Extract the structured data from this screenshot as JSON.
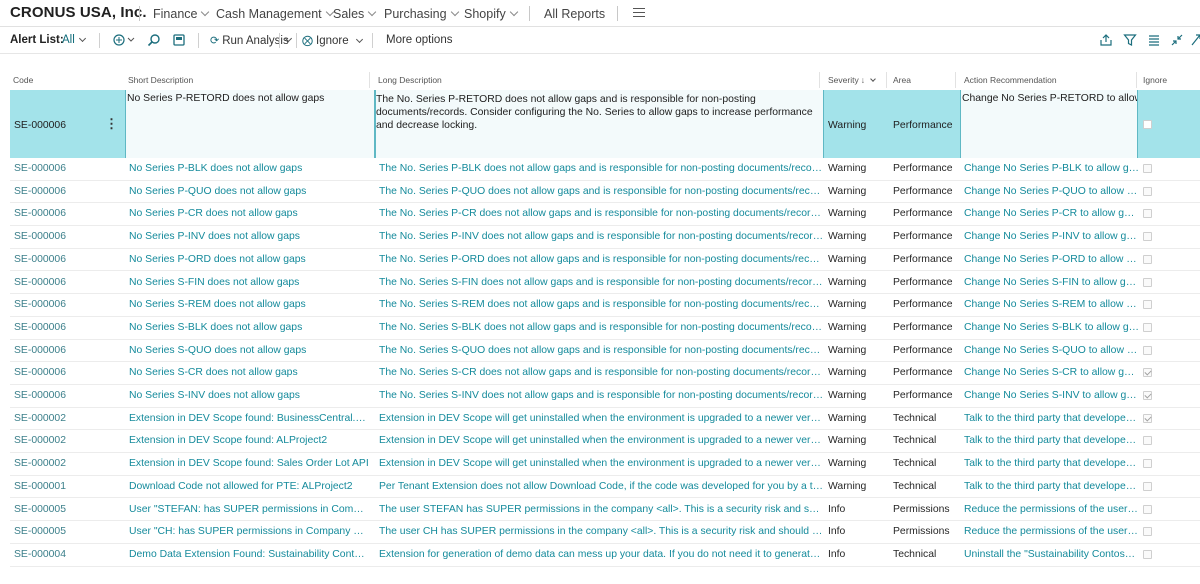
{
  "topnav": {
    "company": "CRONUS USA, Inc.",
    "items": [
      {
        "label": "Finance"
      },
      {
        "label": "Cash Management"
      },
      {
        "label": "Sales"
      },
      {
        "label": "Purchasing"
      },
      {
        "label": "Shopify"
      }
    ],
    "all_reports": "All Reports"
  },
  "actionbar": {
    "alert_list_label": "Alert List:",
    "filter_value": "All",
    "run_analysis": "Run Analysis",
    "ignore": "Ignore",
    "more_options": "More options"
  },
  "columns": {
    "code": "Code",
    "short": "Short Description",
    "long": "Long Description",
    "severity": "Severity",
    "area": "Area",
    "action": "Action Recommendation",
    "ignore": "Ignore"
  },
  "selected": {
    "code": "SE-000006",
    "short": "No Series P-RETORD does not allow gaps",
    "long": "The No. Series P-RETORD does not allow gaps and is responsible for non-posting documents/records. Consider configuring the No. Series to allow gaps to increase performance and decrease locking.",
    "severity": "Warning",
    "area": "Performance",
    "action": "Change No Series P-RETORD to allow gaps",
    "ignore": false
  },
  "rows": [
    {
      "code": "SE-000006",
      "short": "No Series P-BLK does not allow gaps",
      "long": "The No. Series P-BLK does not allow gaps and is responsible for non-posting documents/records. Consider configuring the No. Series to allow gaps",
      "severity": "Warning",
      "area": "Performance",
      "action": "Change No Series P-BLK to allow gaps",
      "ignore": false
    },
    {
      "code": "SE-000006",
      "short": "No Series P-QUO does not allow gaps",
      "long": "The No. Series P-QUO does not allow gaps and is responsible for non-posting documents/records. Consider configuring the No. Series to allow gaps",
      "severity": "Warning",
      "area": "Performance",
      "action": "Change No Series P-QUO to allow gaps",
      "ignore": false
    },
    {
      "code": "SE-000006",
      "short": "No Series P-CR does not allow gaps",
      "long": "The No. Series P-CR does not allow gaps and is responsible for non-posting documents/records. Consider configuring the No. Series to allow gaps",
      "severity": "Warning",
      "area": "Performance",
      "action": "Change No Series P-CR to allow gaps",
      "ignore": false
    },
    {
      "code": "SE-000006",
      "short": "No Series P-INV does not allow gaps",
      "long": "The No. Series P-INV does not allow gaps and is responsible for non-posting documents/records. Consider configuring the No. Series to allow gaps",
      "severity": "Warning",
      "area": "Performance",
      "action": "Change No Series P-INV to allow gaps",
      "ignore": false
    },
    {
      "code": "SE-000006",
      "short": "No Series P-ORD does not allow gaps",
      "long": "The No. Series P-ORD does not allow gaps and is responsible for non-posting documents/records. Consider configuring the No. Series to allow gaps",
      "severity": "Warning",
      "area": "Performance",
      "action": "Change No Series P-ORD to allow gaps",
      "ignore": false
    },
    {
      "code": "SE-000006",
      "short": "No Series S-FIN does not allow gaps",
      "long": "The No. Series S-FIN does not allow gaps and is responsible for non-posting documents/records. Consider configuring the No. Series to allow gaps",
      "severity": "Warning",
      "area": "Performance",
      "action": "Change No Series S-FIN to allow gaps",
      "ignore": false
    },
    {
      "code": "SE-000006",
      "short": "No Series S-REM does not allow gaps",
      "long": "The No. Series S-REM does not allow gaps and is responsible for non-posting documents/records. Consider configuring the No. Series to allow gaps",
      "severity": "Warning",
      "area": "Performance",
      "action": "Change No Series S-REM to allow gaps",
      "ignore": false
    },
    {
      "code": "SE-000006",
      "short": "No Series S-BLK does not allow gaps",
      "long": "The No. Series S-BLK does not allow gaps and is responsible for non-posting documents/records. Consider configuring the No. Series to allow gaps",
      "severity": "Warning",
      "area": "Performance",
      "action": "Change No Series S-BLK to allow gaps",
      "ignore": false
    },
    {
      "code": "SE-000006",
      "short": "No Series S-QUO does not allow gaps",
      "long": "The No. Series S-QUO does not allow gaps and is responsible for non-posting documents/records. Consider configuring the No. Series to allow gaps",
      "severity": "Warning",
      "area": "Performance",
      "action": "Change No Series S-QUO to allow gaps",
      "ignore": false
    },
    {
      "code": "SE-000006",
      "short": "No Series S-CR does not allow gaps",
      "long": "The No. Series S-CR does not allow gaps and is responsible for non-posting documents/records. Consider configuring the No. Series to allow gaps",
      "severity": "Warning",
      "area": "Performance",
      "action": "Change No Series S-CR to allow gaps",
      "ignore": true
    },
    {
      "code": "SE-000006",
      "short": "No Series S-INV does not allow gaps",
      "long": "The No. Series S-INV does not allow gaps and is responsible for non-posting documents/records. Consider configuring the No. Series to allow gaps",
      "severity": "Warning",
      "area": "Performance",
      "action": "Change No Series S-INV to allow gaps",
      "ignore": true
    },
    {
      "code": "SE-000002",
      "short": "Extension in DEV Scope found: BusinessCentral.Sentinel",
      "long": "Extension in DEV Scope will get uninstalled when the environment is upgraded to a newer version. Publishing the extension",
      "severity": "Warning",
      "area": "Technical",
      "action": "Talk to the third party that developed the extension",
      "ignore": true
    },
    {
      "code": "SE-000002",
      "short": "Extension in DEV Scope found: ALProject2",
      "long": "Extension in DEV Scope will get uninstalled when the environment is upgraded to a newer version. Publishing the extension",
      "severity": "Warning",
      "area": "Technical",
      "action": "Talk to the third party that developed the extension",
      "ignore": false
    },
    {
      "code": "SE-000002",
      "short": "Extension in DEV Scope found: Sales Order Lot API",
      "long": "Extension in DEV Scope will get uninstalled when the environment is upgraded to a newer version. Publishing the extension",
      "severity": "Warning",
      "area": "Technical",
      "action": "Talk to the third party that developed the extension",
      "ignore": false
    },
    {
      "code": "SE-000001",
      "short": "Download Code not allowed for PTE: ALProject2",
      "long": "Per Tenant Extension does not allow Download Code, if the code was developed for you by a third party, you",
      "severity": "Warning",
      "area": "Technical",
      "action": "Talk to the third party that developed the extension",
      "ignore": false
    },
    {
      "code": "SE-000005",
      "short": "User \"STEFAN: has SUPER permissions in Company <all>",
      "long": "The user STEFAN has SUPER permissions in the company <all>. This is a security risk and should be reviewed.",
      "severity": "Info",
      "area": "Permissions",
      "action": "Reduce the permissions of the user STEFAN",
      "ignore": false
    },
    {
      "code": "SE-000005",
      "short": "User \"CH: has SUPER permissions in Company <all>",
      "long": "The user CH has SUPER permissions in the company <all>. This is a security risk and should be reviewed.",
      "severity": "Info",
      "area": "Permissions",
      "action": "Reduce the permissions of the user CH in the company",
      "ignore": false
    },
    {
      "code": "SE-000004",
      "short": "Demo Data Extension Found: Sustainability Contoso Coffee Demo Data",
      "long": "Extension for generation of demo data can mess up your data. If you do not need it to generate demo data, uninstall it.",
      "severity": "Info",
      "area": "Technical",
      "action": "Uninstall the \"Sustainability Contoso Coffee Demo Data\"",
      "ignore": false
    }
  ]
}
